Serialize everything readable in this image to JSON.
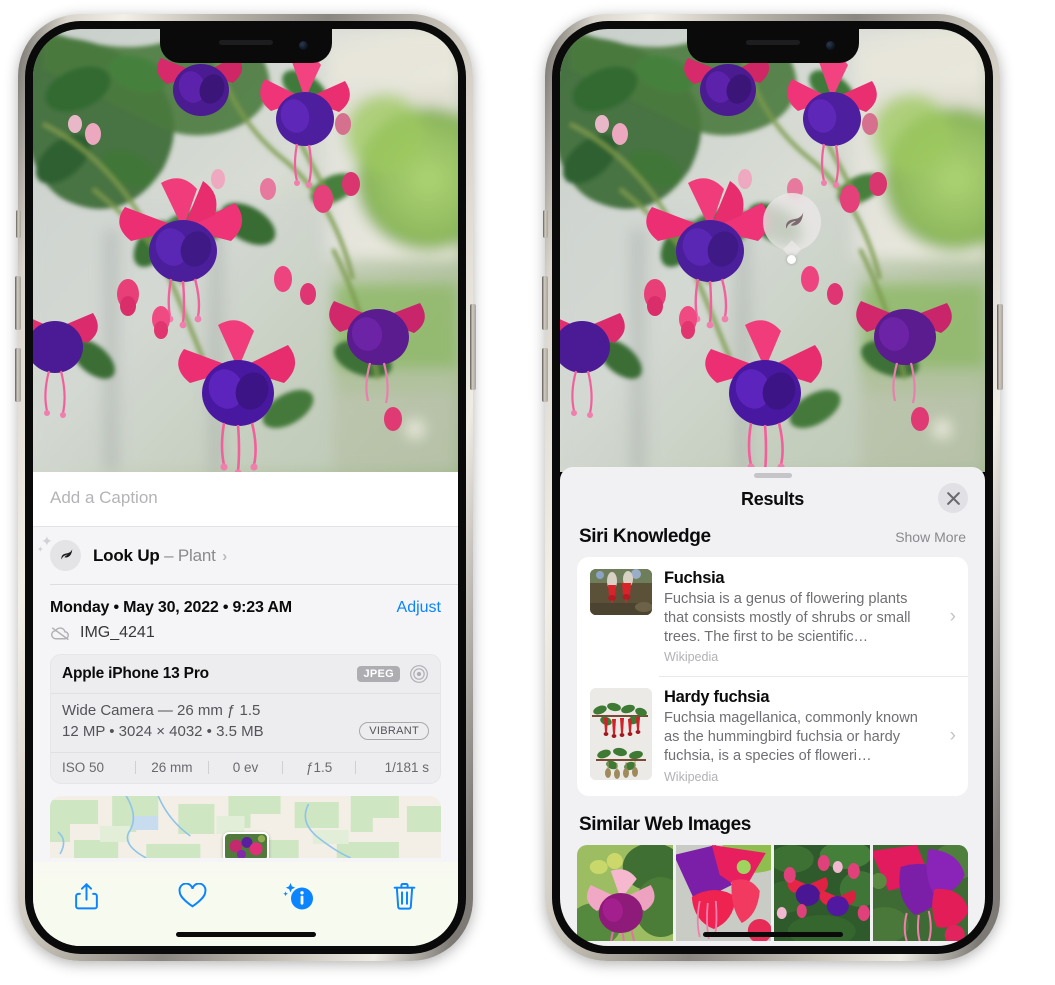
{
  "left_phone": {
    "photo_alt": "fuchsia-flowers-photo",
    "caption_placeholder": "Add a Caption",
    "lookup": {
      "label": "Look Up",
      "separator": "–",
      "subject": "Plant",
      "chevron": "›",
      "icon": "leaf-icon"
    },
    "metadata": {
      "date": "Monday • May 30, 2022 • 9:23 AM",
      "adjust_label": "Adjust",
      "filename": "IMG_4241",
      "cloud_icon": "cloud-slash-icon"
    },
    "exif": {
      "device": "Apple iPhone 13 Pro",
      "format_badge": "JPEG",
      "lens_icon": "aperture-icon",
      "lens_line": "Wide Camera — 26 mm ƒ 1.5",
      "size_line": "12 MP • 3024 × 4032 • 3.5 MB",
      "style_badge": "VIBRANT",
      "stats": [
        "ISO 50",
        "26 mm",
        "0 ev",
        "ƒ1.5",
        "1/181 s"
      ]
    },
    "toolbar": [
      {
        "name": "share-button",
        "icon": "share-icon"
      },
      {
        "name": "favorite-button",
        "icon": "heart-icon"
      },
      {
        "name": "info-button",
        "icon": "info-sparkle-icon"
      },
      {
        "name": "delete-button",
        "icon": "trash-icon"
      }
    ]
  },
  "right_phone": {
    "visual_lookup_badge": {
      "icon": "leaf-icon",
      "name": "visual-look-up-badge"
    },
    "sheet": {
      "title": "Results",
      "close_icon": "close-icon",
      "sections": [
        {
          "title": "Siri Knowledge",
          "action": "Show More",
          "items": [
            {
              "title": "Fuchsia",
              "description": "Fuchsia is a genus of flowering plants that consists mostly of shrubs or small trees. The first to be scientific…",
              "source": "Wikipedia",
              "thumb": "fuchsia-red-flowers-thumb",
              "thumb_shape": "landscape"
            },
            {
              "title": "Hardy fuchsia",
              "description": "Fuchsia magellanica, commonly known as the hummingbird fuchsia or hardy fuchsia, is a species of floweri…",
              "source": "Wikipedia",
              "thumb": "hardy-fuchsia-specimen-thumb",
              "thumb_shape": "portrait"
            }
          ]
        },
        {
          "title": "Similar Web Images",
          "action": "",
          "images": [
            "web-image-purple-fuchsia",
            "web-image-red-fuchsia-closeup",
            "web-image-fuchsia-bush",
            "web-image-purple-pink-fuchsia"
          ]
        }
      ]
    }
  },
  "colors": {
    "accent_blue": "#0a84ff",
    "sheet_bg": "#f1f1f4",
    "card_bg": "#ffffff",
    "secondary_text": "#8a8a8e",
    "badge_gray": "#adadb2"
  }
}
